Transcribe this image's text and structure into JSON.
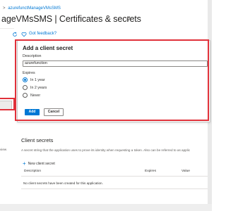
{
  "header": {
    "breadcrumb": [
      ">",
      "azurefunctManageVMsSMS"
    ],
    "title": "ageVMsSMS | Certificates & secrets"
  },
  "toolbar": {
    "feedback_label": "Got feedback?",
    "icons": [
      "refresh-icon",
      "heart-feedback-icon",
      "pin-icon"
    ]
  },
  "dialog": {
    "title": "Add a client secret",
    "description_label": "Description",
    "description_value": "azurefunction",
    "expires_label": "Expires",
    "options": [
      "In 1 year",
      "In 2 years",
      "Never"
    ],
    "selected_option": "In 1 year",
    "add_label": "Add",
    "cancel_label": "Cancel"
  },
  "secrets": {
    "heading": "Client secrets",
    "description": "A secret string that the application uses to prove its identity when requesting a token. Also can be referred to as applic",
    "left_cut_text": "view",
    "new_label": "New client secret",
    "columns": [
      "Description",
      "Expires",
      "Value"
    ],
    "empty_text": "No client secrets have been created for this application."
  },
  "colors": {
    "accent": "#0078d4",
    "highlight": "#e0313a"
  }
}
